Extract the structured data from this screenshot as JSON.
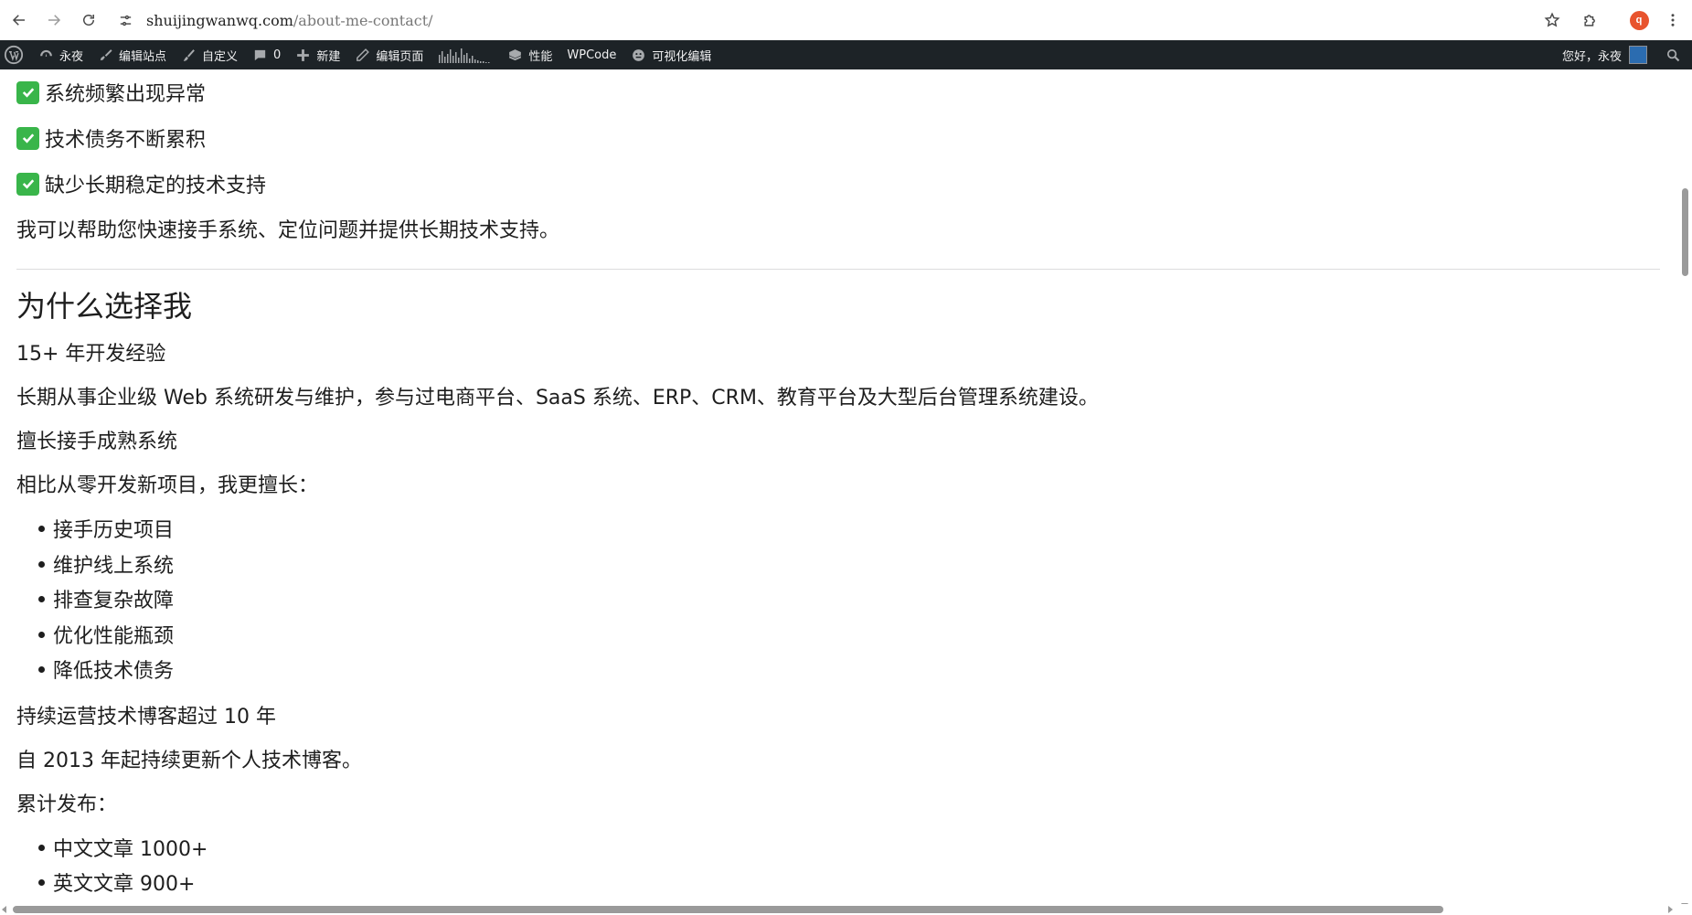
{
  "browser": {
    "url_domain": "shuijingwanwq.com",
    "url_path": "/about-me-contact/",
    "profile_initial": "q",
    "icons": {
      "back": "back-arrow-icon",
      "forward": "forward-arrow-icon",
      "reload": "reload-icon",
      "site_info": "site-settings-icon",
      "bookmark": "star-icon",
      "extensions": "puzzle-piece-icon",
      "menu": "kebab-menu-icon"
    },
    "colors": {
      "profile_bg": "#e8542e"
    }
  },
  "admin_bar": {
    "items": [
      {
        "label": "永夜",
        "icon": "dashboard-icon"
      },
      {
        "label": "编辑站点",
        "icon": "brush-icon"
      },
      {
        "label": "自定义",
        "icon": "paintbrush-icon"
      },
      {
        "label": "0",
        "icon": "comment-icon"
      },
      {
        "label": "新建",
        "icon": "plus-icon"
      },
      {
        "label": "编辑页面",
        "icon": "pencil-icon"
      },
      {
        "label": "性能",
        "icon": "performance-icon"
      },
      {
        "label": "WPCode",
        "icon": ""
      },
      {
        "label": "可视化编辑",
        "icon": "visual-editor-icon"
      }
    ],
    "greeting": "您好，永夜",
    "colors": {
      "background": "#1d2327",
      "text": "#f0f0f1"
    }
  },
  "content": {
    "checklist": [
      "系统频繁出现异常",
      "技术债务不断累积",
      "缺少长期稳定的技术支持"
    ],
    "intro_summary": "我可以帮助您快速接手系统、定位问题并提供长期技术支持。",
    "section_heading": "为什么选择我",
    "experience_title": "15+ 年开发经验",
    "experience_desc": "长期从事企业级 Web 系统研发与维护，参与过电商平台、SaaS 系统、ERP、CRM、教育平台及大型后台管理系统建设。",
    "mature_title": "擅长接手成熟系统",
    "mature_desc": "相比从零开发新项目，我更擅长：",
    "skills": [
      "接手历史项目",
      "维护线上系统",
      "排查复杂故障",
      "优化性能瓶颈",
      "降低技术债务"
    ],
    "blog_title": "持续运营技术博客超过 10 年",
    "blog_desc": "自 2013 年起持续更新个人技术博客。",
    "published_label": "累计发布：",
    "published": [
      "中文文章 1000+",
      "英文文章 900+"
    ],
    "colors": {
      "check_green": "#39b54a"
    }
  }
}
